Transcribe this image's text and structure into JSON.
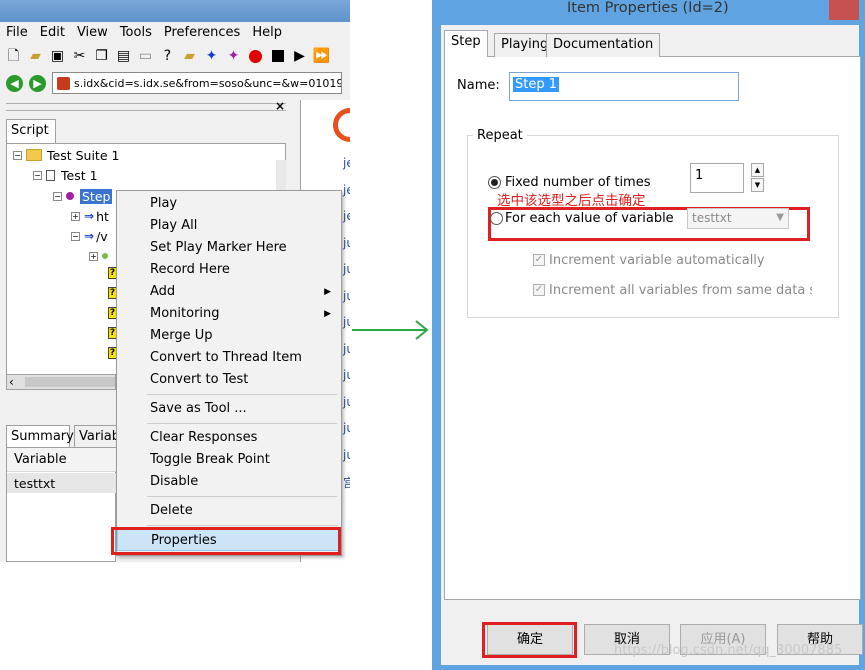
{
  "left_window": {
    "menu": [
      "File",
      "Edit",
      "View",
      "Tools",
      "Preferences",
      "Help"
    ],
    "url": "s.idx&cid=s.idx.se&from=soso&unc=&w=01019900&",
    "tree_tab": "Script",
    "tree": {
      "suite": "Test Suite 1",
      "test": "Test 1",
      "step": "Step",
      "child_1": "ht",
      "child_2": "/v"
    },
    "bottom_tabs": {
      "summary": "Summary",
      "variables": "Variab"
    },
    "variables_table": {
      "header": "Variable",
      "row": "testtxt"
    },
    "browser_fragments": [
      "je",
      "je",
      "je",
      "ju",
      "ju",
      "ju",
      "ju",
      "ju",
      "ju",
      "ju",
      "ju",
      "ju",
      "宫"
    ]
  },
  "context_menu": {
    "items": [
      "Play",
      "Play All",
      "Set Play Marker Here",
      "Record Here",
      "Add",
      "Monitoring",
      "Merge Up",
      "Convert to Thread Item",
      "Convert to Test",
      "Save as Tool ...",
      "Clear Responses",
      "Toggle Break Point",
      "Disable",
      "Delete",
      "Properties"
    ]
  },
  "dialog": {
    "title": "Item Properties (Id=2)",
    "tabs": [
      "Step",
      "Playing",
      "Documentation"
    ],
    "name_label": "Name:",
    "name_value": "Step 1",
    "repeat_label": "Repeat",
    "fixed_label": "Fixed number of times",
    "fixed_times": "1",
    "annotation": "选中该选型之后点击确定",
    "each_label": "For each value of variable",
    "variable_value": "testtxt",
    "check_auto": "Increment variable automatically",
    "check_same": "Increment all variables from same data sourc",
    "buttons": {
      "ok": "确定",
      "cancel": "取消",
      "apply": "应用(A)",
      "help": "帮助"
    }
  },
  "watermark": "https://blog.csdn.net/qq_30007885",
  "colors": {
    "highlight_red": "#e02020",
    "dialog_frame": "#5fa4e0",
    "selection_blue": "#3399ff",
    "arrow_green": "#2aa84a"
  }
}
